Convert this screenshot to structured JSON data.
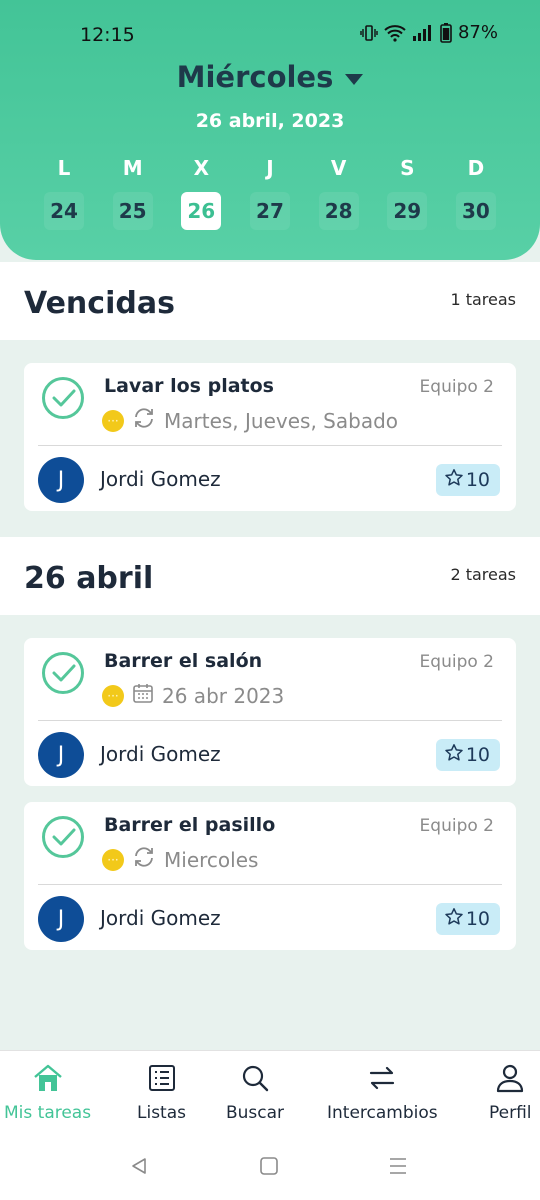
{
  "status_bar": {
    "time": "12:15",
    "battery": "87%"
  },
  "header": {
    "day_name": "Miércoles",
    "date": "26 abril, 2023",
    "week": [
      {
        "letter": "L",
        "num": "24"
      },
      {
        "letter": "M",
        "num": "25"
      },
      {
        "letter": "X",
        "num": "26",
        "active": true
      },
      {
        "letter": "J",
        "num": "27"
      },
      {
        "letter": "V",
        "num": "28"
      },
      {
        "letter": "S",
        "num": "29"
      },
      {
        "letter": "D",
        "num": "30"
      }
    ]
  },
  "sections": [
    {
      "title": "Vencidas",
      "count": "1 tareas",
      "tasks": [
        {
          "title": "Lavar los platos",
          "team": "Equipo 2",
          "meta_icon": "repeat-icon",
          "meta": "Martes, Jueves, Sabado",
          "user": "Jordi Gomez",
          "avatar": "J",
          "points": "10"
        }
      ]
    },
    {
      "title": "26 abril",
      "count": "2 tareas",
      "tasks": [
        {
          "title": "Barrer el salón",
          "team": "Equipo 2",
          "meta_icon": "calendar-icon",
          "meta": "26 abr 2023",
          "user": "Jordi Gomez",
          "avatar": "J",
          "points": "10"
        },
        {
          "title": "Barrer el pasillo",
          "team": "Equipo 2",
          "meta_icon": "repeat-icon",
          "meta": "Miercoles",
          "user": "Jordi Gomez",
          "avatar": "J",
          "points": "10"
        }
      ]
    }
  ],
  "bottom_nav": [
    {
      "label": "Mis tareas",
      "icon": "home-icon",
      "active": true
    },
    {
      "label": "Listas",
      "icon": "list-icon"
    },
    {
      "label": "Buscar",
      "icon": "search-icon"
    },
    {
      "label": "Intercambios",
      "icon": "swap-icon"
    },
    {
      "label": "Perfil",
      "icon": "user-icon"
    }
  ],
  "colors": {
    "accent": "#43c497",
    "avatar": "#0e4d97",
    "points_bg": "#c9ecf7",
    "priority": "#f2c91a"
  }
}
